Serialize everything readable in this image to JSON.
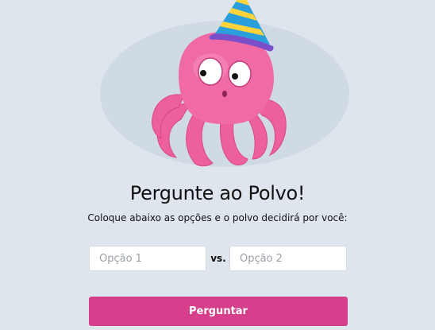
{
  "hero": {
    "image_name": "party-octopus-illustration"
  },
  "page": {
    "title": "Pergunte ao Polvo!",
    "subtitle": "Coloque abaixo as opções e o polvo decidirá por você:"
  },
  "form": {
    "option1_placeholder": "Opção 1",
    "option1_value": "",
    "vs_label": "vs.",
    "option2_placeholder": "Opção 2",
    "option2_value": "",
    "submit_label": "Perguntar"
  },
  "colors": {
    "background": "#dfe5ed",
    "button": "#d63f8c",
    "octopus": "#f06aa6"
  }
}
